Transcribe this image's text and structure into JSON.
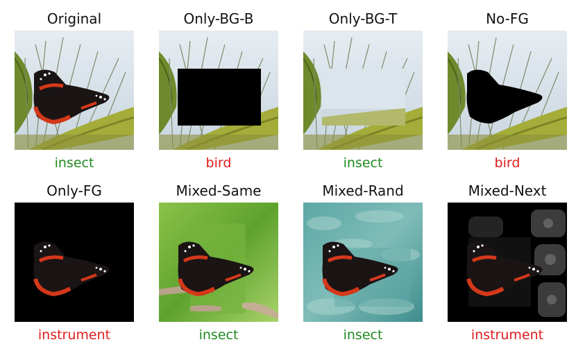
{
  "panels": [
    {
      "title": "Original",
      "prediction": "insect",
      "correct": true
    },
    {
      "title": "Only-BG-B",
      "prediction": "bird",
      "correct": false
    },
    {
      "title": "Only-BG-T",
      "prediction": "insect",
      "correct": true
    },
    {
      "title": "No-FG",
      "prediction": "bird",
      "correct": false
    },
    {
      "title": "Only-FG",
      "prediction": "instrument",
      "correct": false
    },
    {
      "title": "Mixed-Same",
      "prediction": "insect",
      "correct": true
    },
    {
      "title": "Mixed-Rand",
      "prediction": "insect",
      "correct": true
    },
    {
      "title": "Mixed-Next",
      "prediction": "instrument",
      "correct": false
    }
  ],
  "colors": {
    "correct": "#1e8a1e",
    "incorrect": "#e01b1b"
  }
}
